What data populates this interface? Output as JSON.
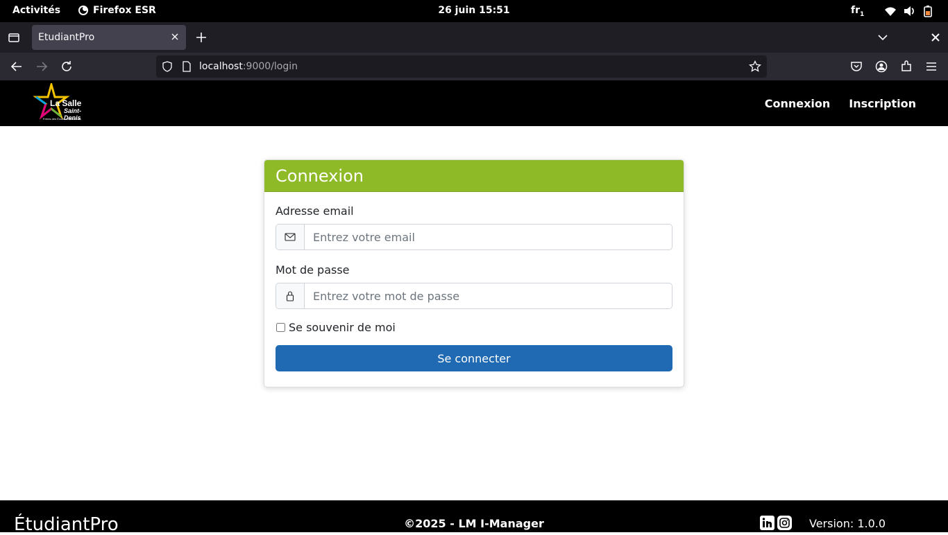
{
  "system_bar": {
    "activities": "Activités",
    "app_name": "Firefox ESR",
    "clock": "26 juin  15:51",
    "lang": "fr",
    "lang_sub": "1"
  },
  "browser": {
    "tab_title": "EtudiantPro",
    "url_host": "localhost",
    "url_rest": ":9000/login"
  },
  "site": {
    "logo_line1": "La Salle",
    "logo_line2": "Saint-Denis",
    "logo_line3": "Frères des Écoles Chrétiennes",
    "nav": {
      "login": "Connexion",
      "register": "Inscription"
    }
  },
  "login_form": {
    "title": "Connexion",
    "email_label": "Adresse email",
    "email_placeholder": "Entrez votre email",
    "password_label": "Mot de passe",
    "password_placeholder": "Entrez votre mot de passe",
    "remember_label": "Se souvenir de moi",
    "submit_label": "Se connecter"
  },
  "footer": {
    "brand": "ÉtudiantPro",
    "copyright": "©2025 - LM I-Manager",
    "version": "Version: 1.0.0"
  },
  "colors": {
    "card_header": "#8fba27",
    "primary_button": "#1f6ab3"
  }
}
